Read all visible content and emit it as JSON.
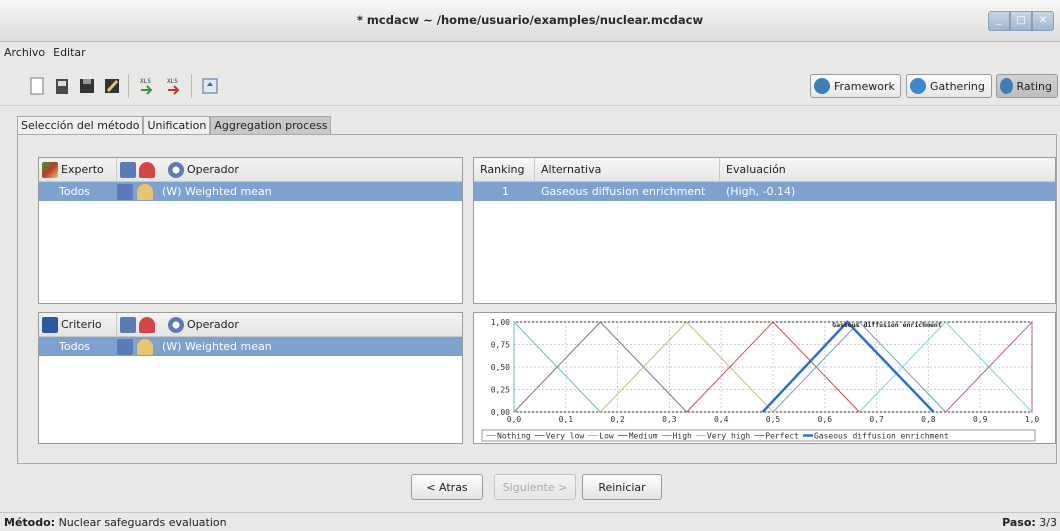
{
  "window": {
    "title": "* mcdacw ~ /home/usuario/examples/nuclear.mcdacw"
  },
  "menu": [
    "Archivo",
    "Editar"
  ],
  "toolbar": {
    "icons": [
      "new-icon",
      "open-icon",
      "save-icon",
      "save-as-icon",
      "import-xls-icon",
      "export-xls-icon",
      "report-icon"
    ],
    "phases": [
      {
        "label": "Framework",
        "icon": "framework-icon",
        "active": false
      },
      {
        "label": "Gathering",
        "icon": "gathering-icon",
        "active": false
      },
      {
        "label": "Rating",
        "icon": "rating-icon",
        "active": true
      }
    ]
  },
  "tabs": [
    "Selección del método",
    "Unification",
    "Aggregation process"
  ],
  "expert_panel": {
    "header": "Experto",
    "operator_header": "Operador",
    "row_name": "Todos",
    "row_operator": "(W) Weighted mean"
  },
  "criteria_panel": {
    "header": "Criterio",
    "operator_header": "Operador",
    "row_name": "Todos",
    "row_operator": "(W) Weighted mean"
  },
  "ranking_table": {
    "columns": [
      "Ranking",
      "Alternativa",
      "Evaluación"
    ],
    "rows": [
      {
        "ranking": "1",
        "alternative": "Gaseous diffusion enrichment",
        "evaluation": "(High, -0.14)"
      }
    ]
  },
  "chart_data": {
    "type": "line",
    "title": "Gaseous diffusion enrichment",
    "xlabel": "",
    "ylabel": "",
    "xlim": [
      0,
      1
    ],
    "ylim": [
      0,
      1
    ],
    "x_ticks": [
      "0,0",
      "0,1",
      "0,2",
      "0,3",
      "0,4",
      "0,5",
      "0,6",
      "0,7",
      "0,8",
      "0,9",
      "1,0"
    ],
    "y_ticks": [
      "0,00",
      "0,25",
      "0,50",
      "0,75",
      "1,00"
    ],
    "grid": true,
    "legend_placement": "bottom",
    "series": [
      {
        "name": "Nothing",
        "color": "#5fc7a7",
        "x": [
          0,
          0,
          0.1667
        ],
        "y": [
          0,
          1,
          0
        ]
      },
      {
        "name": "Very low",
        "color": "#8a6f8a",
        "x": [
          0,
          0.1667,
          0.3333
        ],
        "y": [
          0,
          1,
          0
        ]
      },
      {
        "name": "Low",
        "color": "#c2c27a",
        "x": [
          0.1667,
          0.3333,
          0.5
        ],
        "y": [
          0,
          1,
          0
        ]
      },
      {
        "name": "Medium",
        "color": "#e0474c",
        "x": [
          0.3333,
          0.5,
          0.6667
        ],
        "y": [
          0,
          1,
          0
        ]
      },
      {
        "name": "High",
        "color": "#6fa0e0",
        "x": [
          0.5,
          0.6667,
          0.8333
        ],
        "y": [
          0,
          1,
          0
        ]
      },
      {
        "name": "Very high",
        "color": "#7fd8c8",
        "x": [
          0.6667,
          0.8333,
          1.0
        ],
        "y": [
          0,
          1,
          0
        ]
      },
      {
        "name": "Perfect",
        "color": "#b7618f",
        "x": [
          0.8333,
          1.0,
          1.0
        ],
        "y": [
          0,
          1,
          0
        ]
      },
      {
        "name": "Gaseous diffusion enrichment",
        "color": "#2c6fd6",
        "x": [
          0.48,
          0.6433,
          0.81
        ],
        "y": [
          0,
          1,
          0
        ],
        "bold": true
      }
    ]
  },
  "nav": {
    "back": "< Atras",
    "next": "Siguiente >",
    "reset": "Reiniciar"
  },
  "status": {
    "method_label": "Método:",
    "method_value": "Nuclear safeguards evaluation",
    "step_label": "Paso:",
    "step_value": "3/3"
  }
}
